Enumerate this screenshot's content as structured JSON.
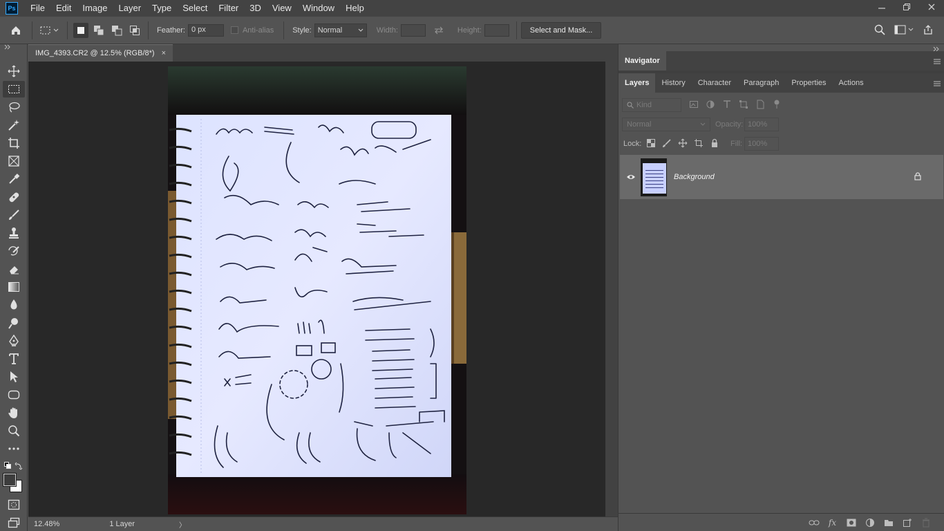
{
  "app": {
    "logo_text": "Ps"
  },
  "menu": [
    "File",
    "Edit",
    "Image",
    "Layer",
    "Type",
    "Select",
    "Filter",
    "3D",
    "View",
    "Window",
    "Help"
  ],
  "window_controls": [
    "minimize-icon",
    "restore-icon",
    "close-icon"
  ],
  "options": {
    "feather_label": "Feather:",
    "feather_value": "0 px",
    "antialias_label": "Anti-alias",
    "style_label": "Style:",
    "style_value": "Normal",
    "width_label": "Width:",
    "height_label": "Height:",
    "select_mask_label": "Select and Mask..."
  },
  "document": {
    "tab_title": "IMG_4393.CR2 @ 12.5% (RGB/8*)",
    "close_glyph": "×"
  },
  "status": {
    "zoom": "12.48%",
    "info": "1 Layer",
    "arrow": "〉"
  },
  "panels": {
    "top_tabs": [
      "Navigator"
    ],
    "layer_tabs": [
      "Layers",
      "History",
      "Character",
      "Paragraph",
      "Properties",
      "Actions"
    ],
    "kind_label": "Kind",
    "blend_mode": "Normal",
    "opacity_label": "Opacity:",
    "opacity_value": "100%",
    "lock_label": "Lock:",
    "fill_label": "Fill:",
    "fill_value": "100%"
  },
  "layers": [
    {
      "name": "Background",
      "visible": true,
      "locked": true
    }
  ],
  "colors": {
    "accent": "#31a8ff",
    "canvas_bg": "#282828",
    "panel_bg": "#535353"
  }
}
